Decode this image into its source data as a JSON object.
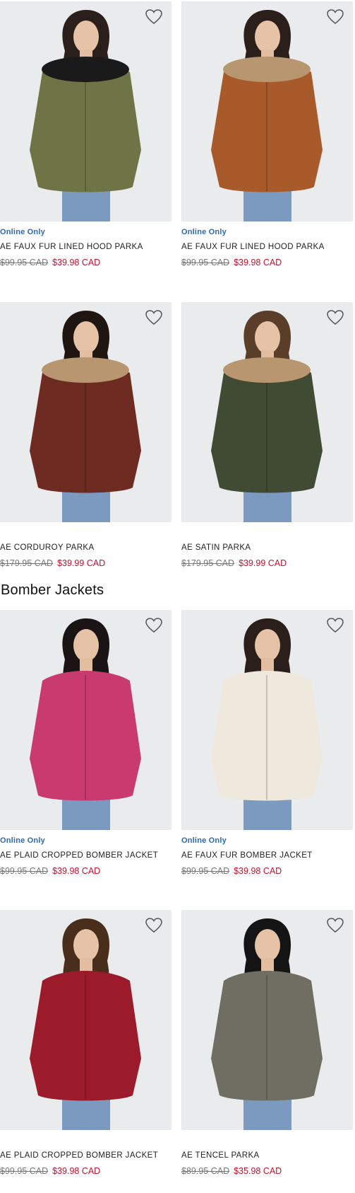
{
  "colors": {
    "accent_blue": "#2e6ab1",
    "sale_red": "#c8102e",
    "image_bg": "#eaebed"
  },
  "sections": [
    {
      "title": ""
    },
    {
      "title": "Bomber Jackets"
    }
  ],
  "products": [
    {
      "badge": "Online Only",
      "name": "AE FAUX FUR LINED HOOD PARKA",
      "was_price": "$99.95 CAD",
      "sale_price": "$39.98 CAD",
      "coat_color": "#6e7445",
      "fur_color": "#1a1a1a",
      "hair_color": "#2a1f1a"
    },
    {
      "badge": "Online Only",
      "name": "AE FAUX FUR LINED HOOD PARKA",
      "was_price": "$99.95 CAD",
      "sale_price": "$39.98 CAD",
      "coat_color": "#a85a2a",
      "fur_color": "#b89670",
      "hair_color": "#2a1f1a"
    },
    {
      "badge": "",
      "name": "AE CORDUROY PARKA",
      "was_price": "$179.95 CAD",
      "sale_price": "$39.99 CAD",
      "coat_color": "#6e2b22",
      "fur_color": "#b89670",
      "hair_color": "#1f1612"
    },
    {
      "badge": "",
      "name": "AE SATIN PARKA",
      "was_price": "$179.95 CAD",
      "sale_price": "$39.99 CAD",
      "coat_color": "#414a32",
      "fur_color": "#b89670",
      "hair_color": "#5a3e2a"
    },
    {
      "badge": "Online Only",
      "name": "AE PLAID CROPPED BOMBER JACKET",
      "was_price": "$99.95 CAD",
      "sale_price": "$39.98 CAD",
      "coat_color": "#c93a6e",
      "fur_color": "",
      "hair_color": "#1a1414"
    },
    {
      "badge": "Online Only",
      "name": "AE FAUX FUR BOMBER JACKET",
      "was_price": "$99.95 CAD",
      "sale_price": "$39.98 CAD",
      "coat_color": "#efe8dc",
      "fur_color": "",
      "hair_color": "#2a1f1a"
    },
    {
      "badge": "",
      "name": "AE PLAID CROPPED BOMBER JACKET",
      "was_price": "$99.95 CAD",
      "sale_price": "$39.98 CAD",
      "coat_color": "#9b1b2a",
      "fur_color": "",
      "hair_color": "#4a2e1c"
    },
    {
      "badge": "",
      "name": "AE TENCEL PARKA",
      "was_price": "$89.95 CAD",
      "sale_price": "$35.98 CAD",
      "coat_color": "#6f6e62",
      "fur_color": "",
      "hair_color": "#141414"
    }
  ]
}
